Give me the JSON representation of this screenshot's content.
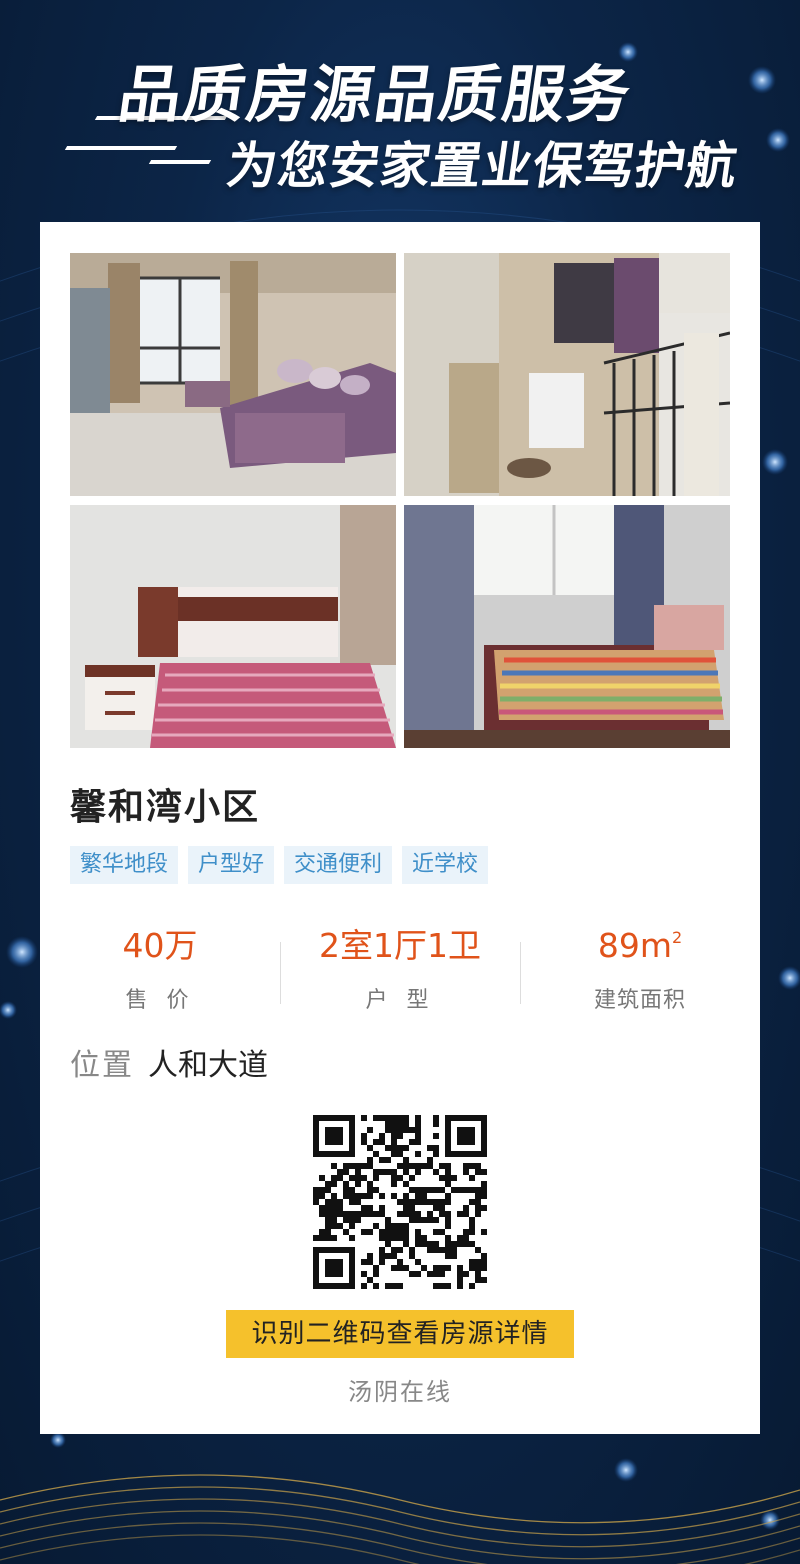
{
  "banner": {
    "line1": "品质房源品质服务",
    "line2": "为您安家置业保驾护航"
  },
  "listing": {
    "title": "馨和湾小区",
    "tags": [
      "繁华地段",
      "户型好",
      "交通便利",
      "近学校"
    ],
    "stats": [
      {
        "value": "40万",
        "label": "售 价"
      },
      {
        "value": "2室1厅1卫",
        "label": "户 型"
      },
      {
        "value": "89m",
        "unit_sup": "2",
        "label": "建筑面积"
      }
    ],
    "location_label": "位置",
    "location_value": "人和大道"
  },
  "photos": [
    {
      "subject": "living-room"
    },
    {
      "subject": "balcony"
    },
    {
      "subject": "bedroom-1"
    },
    {
      "subject": "bedroom-2"
    }
  ],
  "cta_label": "识别二维码查看房源详情",
  "brand_name": "汤阴在线",
  "colors": {
    "accent": "#e0531a",
    "cta_bg": "#f5c12c",
    "tag_bg": "#eaf3fa",
    "tag_text": "#3f8fc9",
    "background": "#0c2547"
  }
}
